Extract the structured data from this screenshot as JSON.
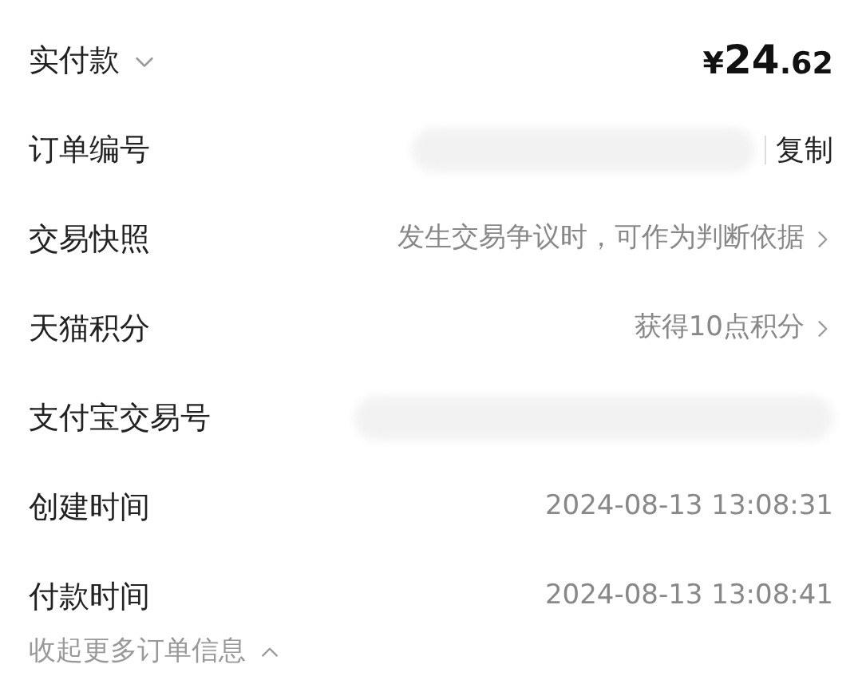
{
  "rows": [
    {
      "kind": "amount",
      "label": "实付款",
      "price": {
        "currency": "¥",
        "integer": "24",
        "decimal": ".62"
      }
    },
    {
      "kind": "copyable",
      "label": "订单编号",
      "action": "复制"
    },
    {
      "kind": "link",
      "label": "交易快照",
      "value": "发生交易争议时，可作为判断依据"
    },
    {
      "kind": "link",
      "label": "天猫积分",
      "value": "获得10点积分"
    },
    {
      "kind": "hidden",
      "label": "支付宝交易号"
    },
    {
      "kind": "text",
      "label": "创建时间",
      "value": "2024-08-13 13:08:31"
    },
    {
      "kind": "text",
      "label": "付款时间",
      "value": "2024-08-13 13:08:41"
    }
  ],
  "collapse_link": "收起更多订单信息"
}
